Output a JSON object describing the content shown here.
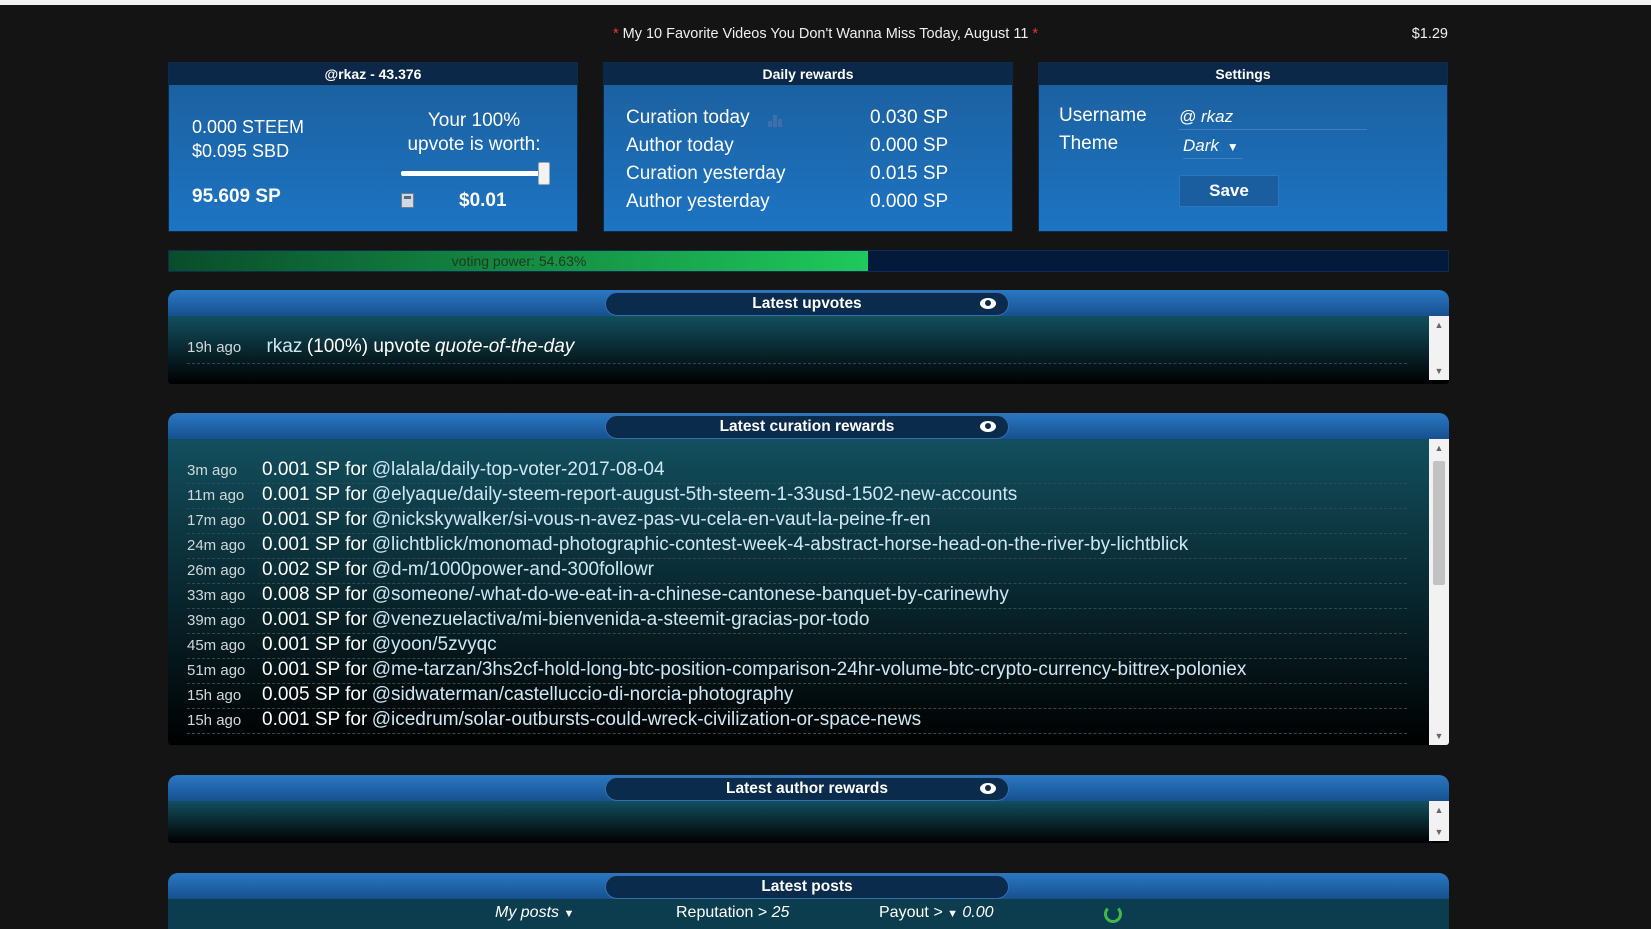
{
  "announcement": {
    "text": "My 10 Favorite Videos You Don't Wanna Miss Today, August 11",
    "star": "*"
  },
  "price": "$1.29",
  "account": {
    "header": "@rkaz - 43.376",
    "steem": "0.000 STEEM",
    "sbd": "$0.095 SBD",
    "sp": "95.609 SP",
    "upvote_label_1": "Your 100%",
    "upvote_label_2": "upvote is worth:",
    "upvote_worth": "$0.01",
    "upvote_percent": 100
  },
  "daily": {
    "header": "Daily rewards",
    "rows": [
      {
        "label": "Curation today",
        "value": "0.030 SP"
      },
      {
        "label": "Author today",
        "value": "0.000 SP"
      },
      {
        "label": "Curation yesterday",
        "value": "0.015 SP"
      },
      {
        "label": "Author yesterday",
        "value": "0.000 SP"
      }
    ]
  },
  "settings": {
    "header": "Settings",
    "username_label": "Username",
    "username_value": "@ rkaz",
    "theme_label": "Theme",
    "theme_value": "Dark",
    "save_label": "Save"
  },
  "voting_power": {
    "label": "voting power: 54.63%",
    "percent": 54.63
  },
  "upvotes": {
    "title": "Latest upvotes",
    "items": [
      {
        "time": "19h ago",
        "user": "rkaz",
        "detail": "(100%) upvote",
        "post": "quote-of-the-day"
      }
    ]
  },
  "curation": {
    "title": "Latest curation rewards",
    "items": [
      {
        "time": "3m ago",
        "amount": "0.001 SP for",
        "link": "@lalala/daily-top-voter-2017-08-04"
      },
      {
        "time": "11m ago",
        "amount": "0.001 SP for",
        "link": "@elyaque/daily-steem-report-august-5th-steem-1-33usd-1502-new-accounts"
      },
      {
        "time": "17m ago",
        "amount": "0.001 SP for",
        "link": "@nickskywalker/si-vous-n-avez-pas-vu-cela-en-vaut-la-peine-fr-en"
      },
      {
        "time": "24m ago",
        "amount": "0.001 SP for",
        "link": "@lichtblick/monomad-photographic-contest-week-4-abstract-horse-head-on-the-river-by-lichtblick"
      },
      {
        "time": "26m ago",
        "amount": "0.002 SP for",
        "link": "@d-m/1000power-and-300followr"
      },
      {
        "time": "33m ago",
        "amount": "0.008 SP for",
        "link": "@someone/-what-do-we-eat-in-a-chinese-cantonese-banquet-by-carinewhy"
      },
      {
        "time": "39m ago",
        "amount": "0.001 SP for",
        "link": "@venezuelactiva/mi-bienvenida-a-steemit-gracias-por-todo"
      },
      {
        "time": "45m ago",
        "amount": "0.001 SP for",
        "link": "@yoon/5zvyqc"
      },
      {
        "time": "51m ago",
        "amount": "0.001 SP for",
        "link": "@me-tarzan/3hs2cf-hold-long-btc-position-comparison-24hr-volume-btc-crypto-currency-bittrex-poloniex"
      },
      {
        "time": "15h ago",
        "amount": "0.005 SP for",
        "link": "@sidwaterman/castelluccio-di-norcia-photography"
      },
      {
        "time": "15h ago",
        "amount": "0.001 SP for",
        "link": "@icedrum/solar-outbursts-could-wreck-civilization-or-space-news"
      }
    ]
  },
  "author": {
    "title": "Latest author rewards"
  },
  "posts": {
    "title": "Latest posts",
    "filter_posts": "My posts",
    "reputation_label": "Reputation >",
    "reputation_value": "25",
    "payout_label": "Payout",
    "payout_op": ">",
    "payout_value": "0.00"
  },
  "colors": {
    "card": "#1d74c3",
    "header": "#0b2848",
    "voting_fill": "#1fc95c",
    "accent_link": "#cde7f5"
  }
}
